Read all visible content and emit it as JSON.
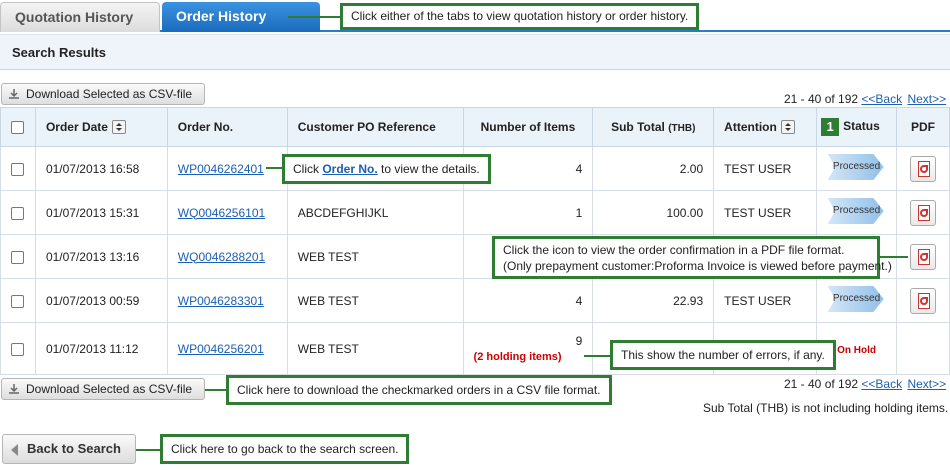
{
  "tabs": [
    {
      "label": "Quotation History",
      "active": false
    },
    {
      "label": "Order History",
      "active": true
    }
  ],
  "results_header": "Search Results",
  "buttons": {
    "download_csv": "Download Selected as CSV-file",
    "back_to_search": "Back to Search"
  },
  "pager": {
    "range": "21 - 40 of 192",
    "back": "<<Back",
    "next": "Next>>"
  },
  "table": {
    "headers": [
      "Order Date",
      "Order No.",
      "Customer PO Reference",
      "Number of Items",
      "Sub Total",
      "(THB)",
      "Attention",
      "Status",
      "PDF"
    ],
    "step_marker": "1",
    "rows": [
      {
        "date": "01/07/2013 16:58",
        "order_no": "WP0046262401",
        "po_ref": "",
        "items": "4",
        "subtotal": "2.00",
        "attention": "TEST USER",
        "status": "Processed"
      },
      {
        "date": "01/07/2013 15:31",
        "order_no": "WQ0046256101",
        "po_ref": "ABCDEFGHIJKL",
        "items": "1",
        "subtotal": "100.00",
        "attention": "TEST USER",
        "status": "Processed"
      },
      {
        "date": "01/07/2013 13:16",
        "order_no": "WQ0046288201",
        "po_ref": "WEB TEST",
        "items": "",
        "subtotal": "",
        "attention": "",
        "status": ""
      },
      {
        "date": "01/07/2013 00:59",
        "order_no": "WP0046283301",
        "po_ref": "WEB TEST",
        "items": "4",
        "subtotal": "22.93",
        "attention": "TEST USER",
        "status": "Processed"
      },
      {
        "date": "01/07/2013 11:12",
        "order_no": "WP0046256201",
        "po_ref": "WEB TEST",
        "items": "9",
        "holding": "(2 holding items)",
        "subtotal": "",
        "attention": "",
        "status": "On Hold"
      }
    ]
  },
  "subtotal_note": "Sub Total (THB) is not including holding items.",
  "callouts": {
    "tabs": "Click either of the tabs to view quotation history or order history.",
    "order_no_prefix": "Click",
    "order_no_link": "Order  No.",
    "order_no_suffix": "to view the details.",
    "pdf_line1": "Click the icon to view the order confirmation in a PDF file format.",
    "pdf_line2": "(Only prepayment customer:Proforma Invoice is viewed before payment.)",
    "errors": "This show the number of errors, if any.",
    "csv": "Click here to download the checkmarked orders in a CSV file format.",
    "back": "Click here to go back to the search screen."
  },
  "colors": {
    "accent": "#1b6bbd",
    "callout_border": "#2e7d32",
    "link": "#1a5fb4",
    "alert": "#cc0000"
  }
}
